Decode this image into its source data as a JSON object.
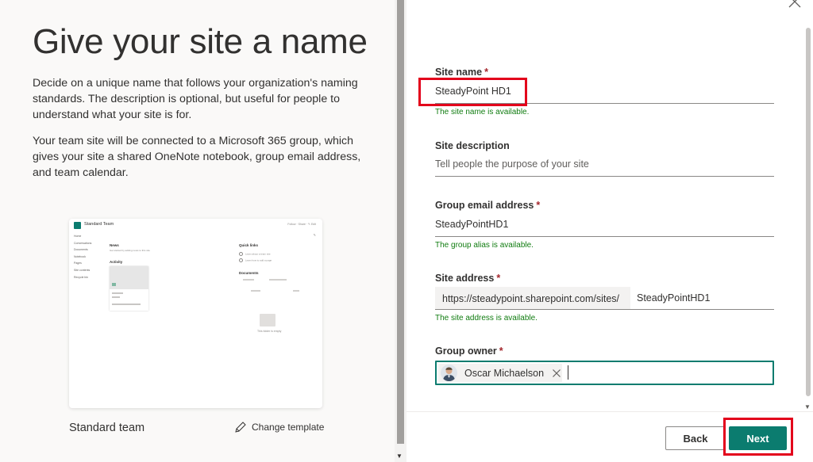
{
  "left": {
    "title": "Give your site a name",
    "paragraph1": "Decide on a unique name that follows your organization's naming standards. The description is optional, but useful for people to understand what your site is for.",
    "paragraph2": "Your team site will be connected to a Microsoft 365 group, which gives your site a shared OneNote notebook, group email address, and team calendar.",
    "template_name": "Standard team",
    "change_template": "Change template",
    "preview": {
      "site_title": "Standard Team",
      "actions": "Follow  ·  Share  ·  ✎ Edit",
      "nav": [
        "Home",
        "Conversations",
        "Documents",
        "Notebook",
        "Pages",
        "Site contents",
        "Recycle bin"
      ],
      "news": "News",
      "news_sub": "Get started by adding news to this site",
      "activity": "Activity",
      "quick_links": "Quick links",
      "quick_link_items": [
        "Learn about a team site",
        "Learn how to add a page"
      ],
      "documents": "Documents",
      "empty_folder": "This folder is empty"
    }
  },
  "form": {
    "site_name": {
      "label": "Site name",
      "required": "*",
      "value": "SteadyPoint HD1",
      "status": "The site name is available."
    },
    "site_description": {
      "label": "Site description",
      "placeholder": "Tell people the purpose of your site"
    },
    "group_email": {
      "label": "Group email address",
      "required": "*",
      "value": "SteadyPointHD1",
      "status": "The group alias is available."
    },
    "site_address": {
      "label": "Site address",
      "required": "*",
      "prefix": "https://steadypoint.sharepoint.com/sites/",
      "value": "SteadyPointHD1",
      "status": "The site address is available."
    },
    "group_owner": {
      "label": "Group owner",
      "required": "*",
      "owner_name": "Oscar Michaelson"
    }
  },
  "buttons": {
    "back": "Back",
    "next": "Next"
  },
  "colors": {
    "accent": "#0b7c6f",
    "success": "#107c10",
    "required": "#a4262c",
    "highlight": "#e3001b"
  }
}
